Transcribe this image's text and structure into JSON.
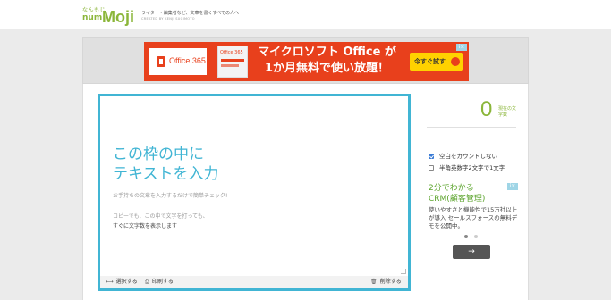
{
  "header": {
    "logo_small": "なんもじ",
    "logo_num": "num",
    "logo_moji": "Moji",
    "tagline": "ライター・編集者など、文章を書くすべての人へ",
    "credit": "CREATED BY KENJI SUGIMOTO"
  },
  "top_ad": {
    "brand": "Office 365",
    "package_label": "Office 365",
    "headline_line1": "マイクロソフト Office が",
    "headline_line2": "1か月無料で使い放題！",
    "cta_label": "今すぐ試す",
    "adchoice": "i×",
    "colors": {
      "background": "#e8401c",
      "cta": "#ffd200"
    }
  },
  "editor": {
    "heading_line1": "この枠の中に",
    "heading_line2": "テキストを入力",
    "sub": "お手持ちの文章を入力するだけで簡単チェック!",
    "note1": "コピーでも、この中で文字を打っても、",
    "note2": "すぐに文字数を表示します",
    "footer": {
      "select_label": "選択する",
      "print_label": "印刷する",
      "delete_label": "削除する"
    },
    "accent_color": "#41b5d4"
  },
  "counter": {
    "value": "0",
    "label": "現在の文字数",
    "color": "#8bb63a"
  },
  "options": [
    {
      "label": "空白をカウントしない",
      "checked": true
    },
    {
      "label": "半角英数字2文字で1文字",
      "checked": false
    }
  ],
  "side_ad": {
    "line1": "2分でわかる",
    "line2": "CRM(顧客管理)",
    "body": "使いやすさと機能性で15万社以上が導入 セールスフォースの無料デモを公開中。",
    "adchoice": "i×",
    "next_label": "→",
    "carousel_active": 0,
    "carousel_count": 2
  }
}
